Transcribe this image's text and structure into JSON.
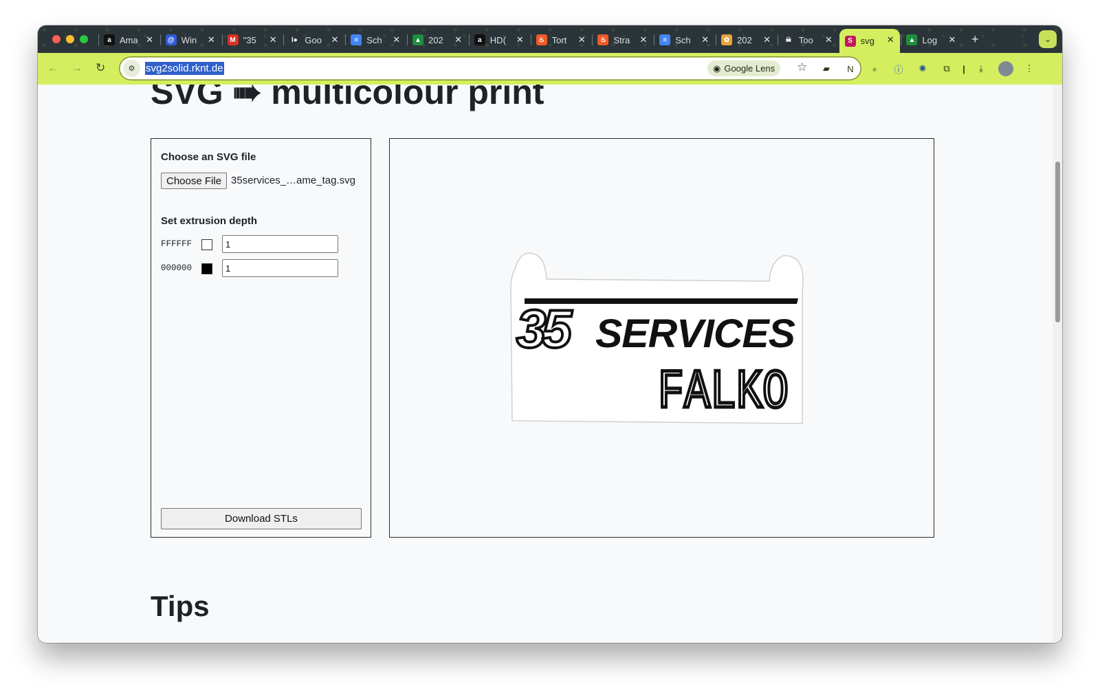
{
  "browser": {
    "tabs": [
      {
        "title": "Ama",
        "favicon": "amazon-icon",
        "favicon_text": "a",
        "favicon_color": "#111111"
      },
      {
        "title": "Win",
        "favicon": "globe-icon",
        "favicon_text": "@",
        "favicon_color": "#2e5bd8"
      },
      {
        "title": "\"35",
        "favicon": "gmail-icon",
        "favicon_text": "M",
        "favicon_color": "#d93025"
      },
      {
        "title": "Goo",
        "favicon": "lens-icon",
        "favicon_text": "I●",
        "favicon_color": "#2b3438"
      },
      {
        "title": "Sch",
        "favicon": "docs-icon",
        "favicon_text": "≡",
        "favicon_color": "#4285f4"
      },
      {
        "title": "202",
        "favicon": "drive-icon",
        "favicon_text": "▲",
        "favicon_color": "#1e8e3e"
      },
      {
        "title": "HD(",
        "favicon": "amazon-icon",
        "favicon_text": "a",
        "favicon_color": "#111111"
      },
      {
        "title": "Tort",
        "favicon": "strato-icon",
        "favicon_text": "♨",
        "favicon_color": "#f05a28"
      },
      {
        "title": "Stra",
        "favicon": "strato-icon",
        "favicon_text": "♨",
        "favicon_color": "#f05a28"
      },
      {
        "title": "Sch",
        "favicon": "docs-icon",
        "favicon_text": "≡",
        "favicon_color": "#4285f4"
      },
      {
        "title": "202",
        "favicon": "photos-icon",
        "favicon_text": "✿",
        "favicon_color": "#e8a33b"
      },
      {
        "title": "Too",
        "favicon": "skull-icon",
        "favicon_text": "☠",
        "favicon_color": "#2b3438"
      },
      {
        "title": "svg",
        "favicon": "svg2solid-icon",
        "favicon_text": "S",
        "favicon_color": "#c2185b",
        "active": true
      },
      {
        "title": "Log",
        "favicon": "drive-icon",
        "favicon_text": "▲",
        "favicon_color": "#1e8e3e"
      }
    ],
    "close_glyph": "✕",
    "new_tab_glyph": "+",
    "tab_search_glyph": "⌄",
    "url": "svg2solid.rknt.de",
    "lens_label": "Google Lens",
    "accent": "#d4ee60"
  },
  "page": {
    "title": "SVG ➠ multicolour print",
    "choose_label": "Choose an SVG file",
    "choose_button": "Choose File",
    "file_name": "35services_…ame_tag.svg",
    "depth_label": "Set extrusion depth",
    "colors": [
      {
        "hex": "FFFFFF",
        "swatch": "#ffffff",
        "depth": "1"
      },
      {
        "hex": "000000",
        "swatch": "#000000",
        "depth": "1"
      }
    ],
    "download_button": "Download STLs",
    "tips_heading": "Tips",
    "preview": {
      "line1": "35SERVICES",
      "line2": "FALKO"
    }
  }
}
